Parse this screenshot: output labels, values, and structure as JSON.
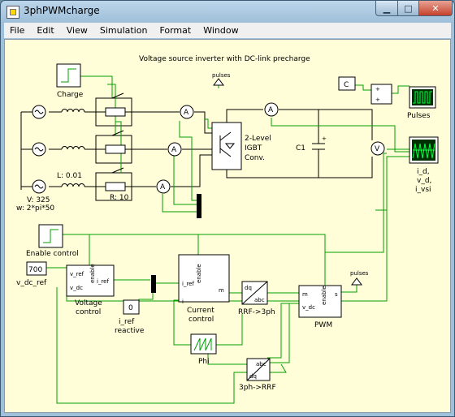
{
  "window": {
    "title": "3phPWMcharge",
    "min_glyph": "▁",
    "max_glyph": "□",
    "close_glyph": "✕"
  },
  "menu": [
    "File",
    "Edit",
    "View",
    "Simulation",
    "Format",
    "Window"
  ],
  "diagram": {
    "title": "Voltage source inverter with DC-link precharge",
    "charge": "Charge",
    "pulses_top": "pulses",
    "const_c": "C",
    "plus": "+",
    "pulses_scope": "Pulses",
    "igbt_1": "2-Level",
    "igbt_2": "IGBT",
    "igbt_3": "Conv.",
    "c1": "C1",
    "scope2_1": "i_d,",
    "scope2_2": "v_d,",
    "scope2_3": "i_vsi",
    "L": "L: 0.01",
    "R": "R: 10",
    "V": "V: 325",
    "w": "w: 2*pi*50",
    "ammeter": "A",
    "voltmeter": "V",
    "enable_control": "Enable control",
    "v_dc_val": "700",
    "v_dc_ref": "v_dc_ref",
    "port_v_ref": "v_ref",
    "port_v_dc": "v_dc",
    "port_enable": "enable",
    "port_i_ref": "i_ref",
    "voltage_control_1": "Voltage",
    "voltage_control_2": "control",
    "i_ref_val": "0",
    "i_ref_reactive_1": "i_ref",
    "i_ref_reactive_2": "reactive",
    "port_i": "i",
    "port_m": "m",
    "current_control_1": "Current",
    "current_control_2": "control",
    "port_dq": "dq",
    "port_abc": "abc",
    "rrf_3ph": "RRF->3ph",
    "port_s": "s",
    "pwm": "PWM",
    "pulses_out": "pulses",
    "phi": "Phi",
    "threeph_rrf": "3ph->RRF"
  }
}
